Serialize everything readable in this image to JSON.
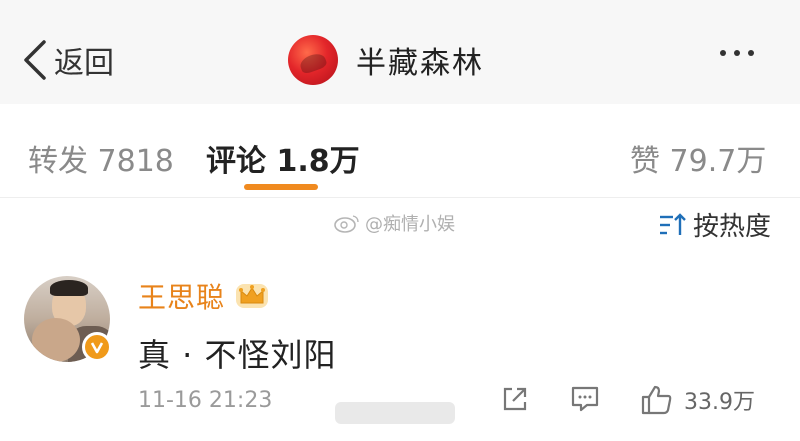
{
  "header": {
    "back_label": "返回",
    "title": "半藏森林"
  },
  "tabs": {
    "repost": "转发 7818",
    "comment": "评论 1.8万",
    "like": "赞 79.7万"
  },
  "sort": {
    "label": "按热度"
  },
  "watermark": {
    "text": "@痴情小娱"
  },
  "comment": {
    "username": "王思聪",
    "text": "真 · 不怪刘阳",
    "time": "11-16 21:23",
    "like_count": "33.9万"
  },
  "colors": {
    "accent_orange": "#f08a1f",
    "username_orange": "#e8831a",
    "header_bg": "#f7f7f7"
  },
  "icons": [
    "back-chevron-icon",
    "more-icon",
    "sort-icon",
    "crown-icon",
    "verified-v-icon",
    "share-icon",
    "reply-icon",
    "thumbs-up-icon"
  ]
}
